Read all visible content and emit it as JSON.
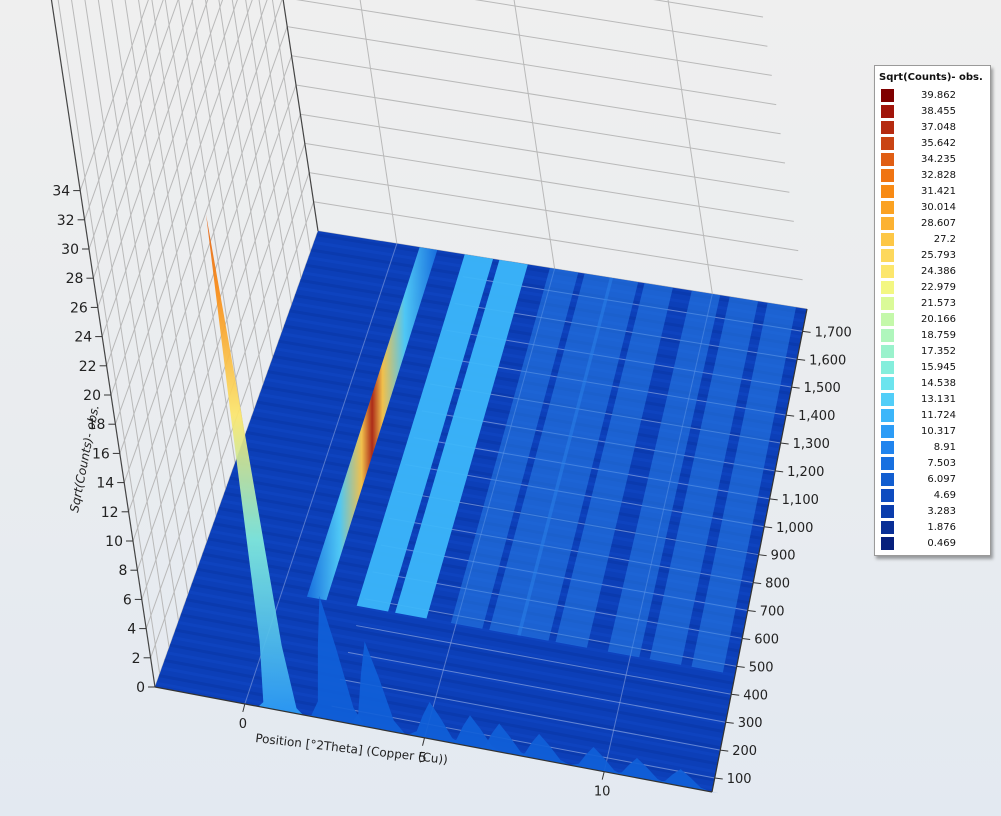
{
  "chart_data": {
    "type": "heatmap",
    "subtype": "3d-surface",
    "title": "",
    "xlabel": "Position [°2Theta] (Copper (Cu))",
    "ylabel": "",
    "zlabel": "Sqrt(Counts)- obs.",
    "x_ticks": [
      "0",
      "5",
      "10"
    ],
    "xlim": [
      -2.5,
      13
    ],
    "y_ticks": [
      "100",
      "200",
      "300",
      "400",
      "500",
      "600",
      "700",
      "800",
      "900",
      "1,000",
      "1,100",
      "1,200",
      "1,300",
      "1,400",
      "1,500",
      "1,600",
      "1,700"
    ],
    "ylim": [
      50,
      1780
    ],
    "z_ticks": [
      "0",
      "2",
      "4",
      "6",
      "8",
      "10",
      "12",
      "14",
      "16",
      "18",
      "20",
      "22",
      "24",
      "26",
      "28",
      "30",
      "32",
      "34"
    ],
    "zlim": [
      0,
      34
    ],
    "grid": true,
    "legend": {
      "title": "Sqrt(Counts)- obs.",
      "placement": "right",
      "items": [
        {
          "label": "39.862",
          "color": "#7f0000"
        },
        {
          "label": "38.455",
          "color": "#a1140a"
        },
        {
          "label": "37.048",
          "color": "#b52a10"
        },
        {
          "label": "35.642",
          "color": "#c94414"
        },
        {
          "label": "34.235",
          "color": "#e05e14"
        },
        {
          "label": "32.828",
          "color": "#f07412"
        },
        {
          "label": "31.421",
          "color": "#f88a14"
        },
        {
          "label": "30.014",
          "color": "#fba222"
        },
        {
          "label": "28.607",
          "color": "#fcb232"
        },
        {
          "label": "27.2",
          "color": "#fdc746"
        },
        {
          "label": "25.793",
          "color": "#fdd85c"
        },
        {
          "label": "24.386",
          "color": "#fce66c"
        },
        {
          "label": "22.979",
          "color": "#f3f782"
        },
        {
          "label": "21.573",
          "color": "#dafa98"
        },
        {
          "label": "20.166",
          "color": "#c4f8aa"
        },
        {
          "label": "18.759",
          "color": "#aff6bc"
        },
        {
          "label": "17.352",
          "color": "#9af2cc"
        },
        {
          "label": "15.945",
          "color": "#84eedc"
        },
        {
          "label": "14.538",
          "color": "#6ce4ee"
        },
        {
          "label": "13.131",
          "color": "#52cef8"
        },
        {
          "label": "11.724",
          "color": "#3cb6fa"
        },
        {
          "label": "10.317",
          "color": "#2c9cf6"
        },
        {
          "label": "8.91",
          "color": "#2084ee"
        },
        {
          "label": "7.503",
          "color": "#1870e0"
        },
        {
          "label": "6.097",
          "color": "#125ed0"
        },
        {
          "label": "4.69",
          "color": "#0e4cc0"
        },
        {
          "label": "3.283",
          "color": "#0a3cac"
        },
        {
          "label": "1.876",
          "color": "#082e96"
        },
        {
          "label": "0.469",
          "color": "#061f7c"
        }
      ]
    },
    "ridges": [
      {
        "x": 1.0,
        "peak_z": 34.0
      },
      {
        "x": 2.6,
        "peak_z": 8.6
      },
      {
        "x": 3.7,
        "peak_z": 6.0
      },
      {
        "x": 5.3,
        "peak_z": 2.6
      },
      {
        "x": 6.4,
        "peak_z": 2.2
      },
      {
        "x": 7.2,
        "peak_z": 2.0
      },
      {
        "x": 8.3,
        "peak_z": 1.8
      },
      {
        "x": 9.8,
        "peak_z": 1.6
      },
      {
        "x": 11.0,
        "peak_z": 1.4
      },
      {
        "x": 12.2,
        "peak_z": 1.2
      }
    ]
  }
}
